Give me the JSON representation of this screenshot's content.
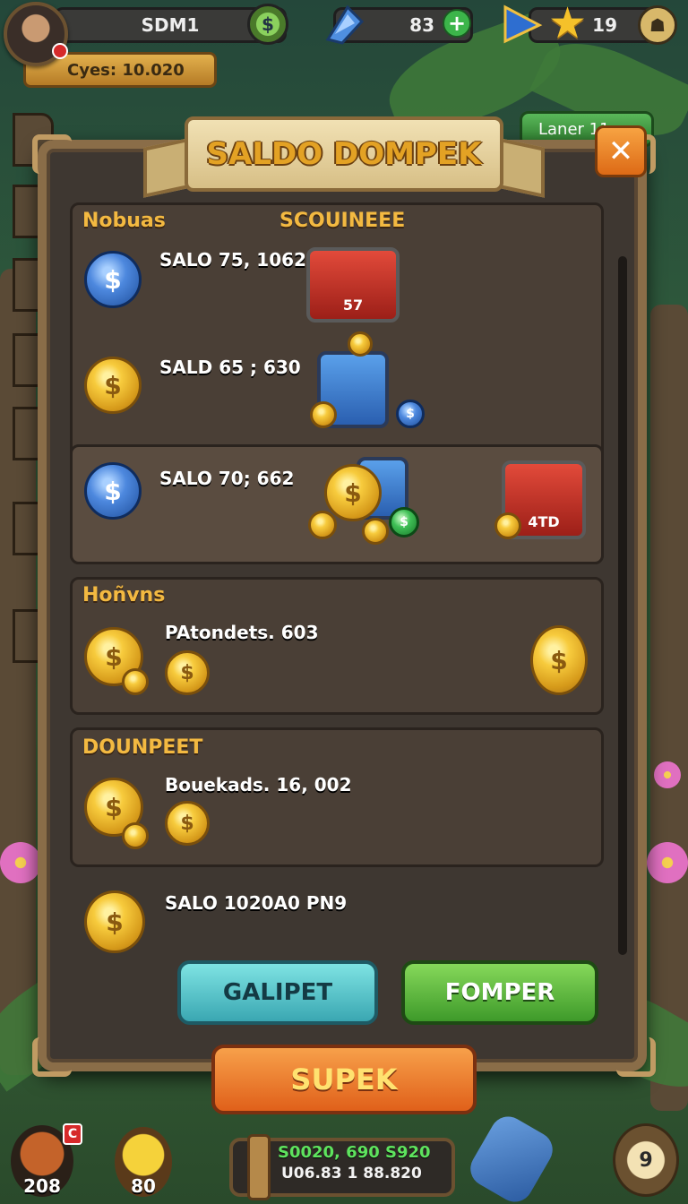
{
  "hud": {
    "player_name": "SDM1",
    "cyes_label": "Cyes: 10.020",
    "gem_count": "83",
    "star_count": "19",
    "laner_label": "Laner 11"
  },
  "modal": {
    "title": "SALDO DOMPEK",
    "close_symbol": "✕",
    "section1": {
      "title_left": "Nobuas",
      "title_right": "SCOUINEEE",
      "rows": [
        {
          "text": "SALO  75, 1062",
          "chest_label": "57"
        },
        {
          "text": "SALD  65 ; 630"
        },
        {
          "text": "SALO  70; 662",
          "chest_label": "4TD"
        }
      ]
    },
    "section2": {
      "title": "Hoñvns",
      "row_text": "PAtondets. 603"
    },
    "section3": {
      "title": "DOUNPEET",
      "rows": [
        {
          "text": "Bouekads. 16, 002"
        },
        {
          "text": "SALO 1020A0 PN9"
        }
      ]
    },
    "buttons": {
      "teal": "GALIPET",
      "green": "FOMPER",
      "orange": "SUPEK"
    }
  },
  "bottom": {
    "left_count": "208",
    "potion_count": "80",
    "wallet_line1": "S0020, 690 S920",
    "wallet_line2": "U06.83 1 88.820",
    "right_badge": "9"
  },
  "colors": {
    "gold": "#f3b941",
    "modal_bg": "#3e3731",
    "frame": "#8a6d48",
    "accent_orange": "#e0601a"
  }
}
